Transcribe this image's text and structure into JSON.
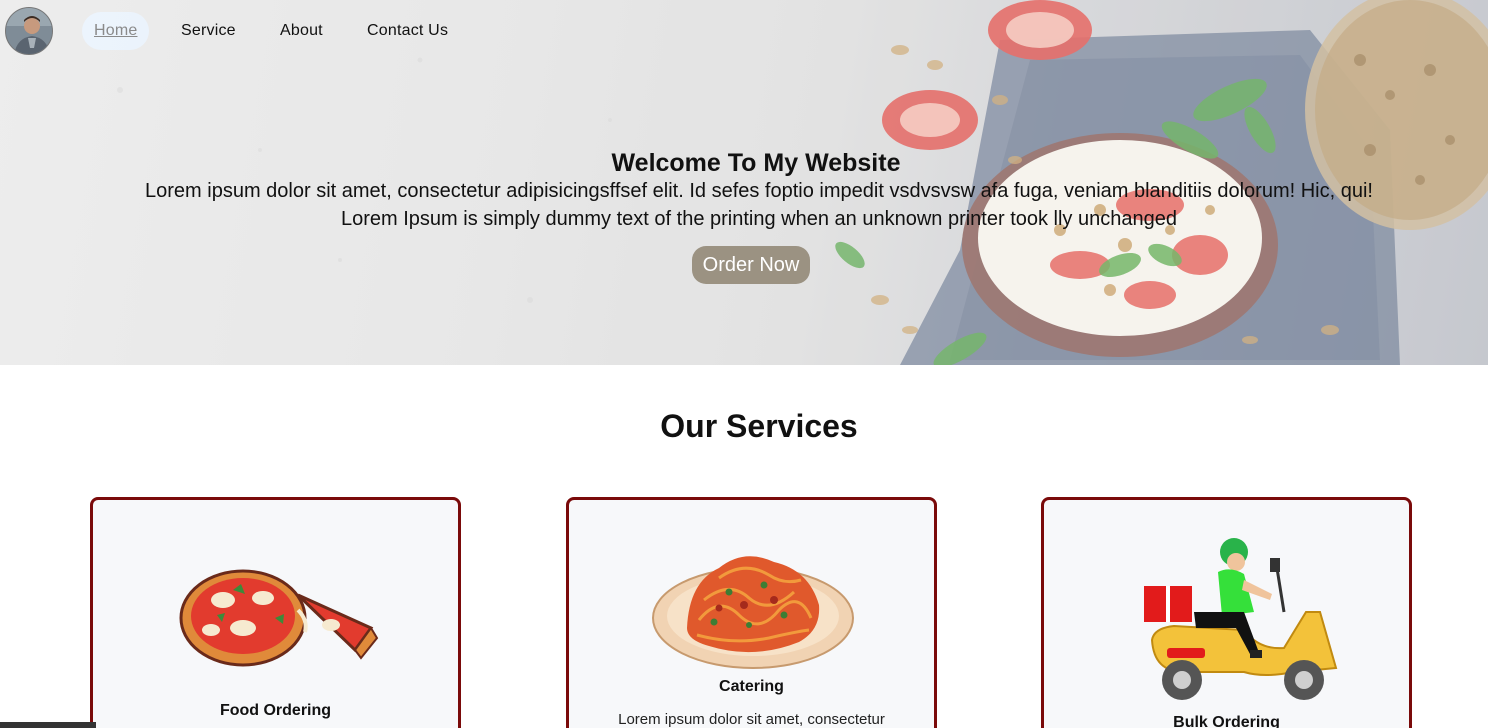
{
  "nav": {
    "items": [
      {
        "label": "Home",
        "active": true
      },
      {
        "label": "Service",
        "active": false
      },
      {
        "label": "About",
        "active": false
      },
      {
        "label": "Contact Us",
        "active": false
      }
    ]
  },
  "hero": {
    "title": "Welcome To My Website",
    "line1": "Lorem ipsum dolor sit amet, consectetur adipisicingsffsef elit. Id sefes foptio impedit vsdvsvsw afa fuga, veniam blanditiis dolorum! Hic, qui!",
    "line2": "Lorem Ipsum is simply dummy text of the printing when an unknown printer took lly unchanged",
    "cta_label": "Order Now"
  },
  "services": {
    "title": "Our Services",
    "cards": [
      {
        "title": "Food Ordering",
        "icon": "pizza-icon"
      },
      {
        "title": "Catering",
        "icon": "spaghetti-icon",
        "text": "Lorem ipsum dolor sit amet, consectetur"
      },
      {
        "title": "Bulk Ordering",
        "icon": "delivery-scooter-icon"
      }
    ]
  },
  "colors": {
    "card_border": "#7a0a0a",
    "cta_background": "#9b9282",
    "active_nav_background": "#ebf5ff"
  }
}
